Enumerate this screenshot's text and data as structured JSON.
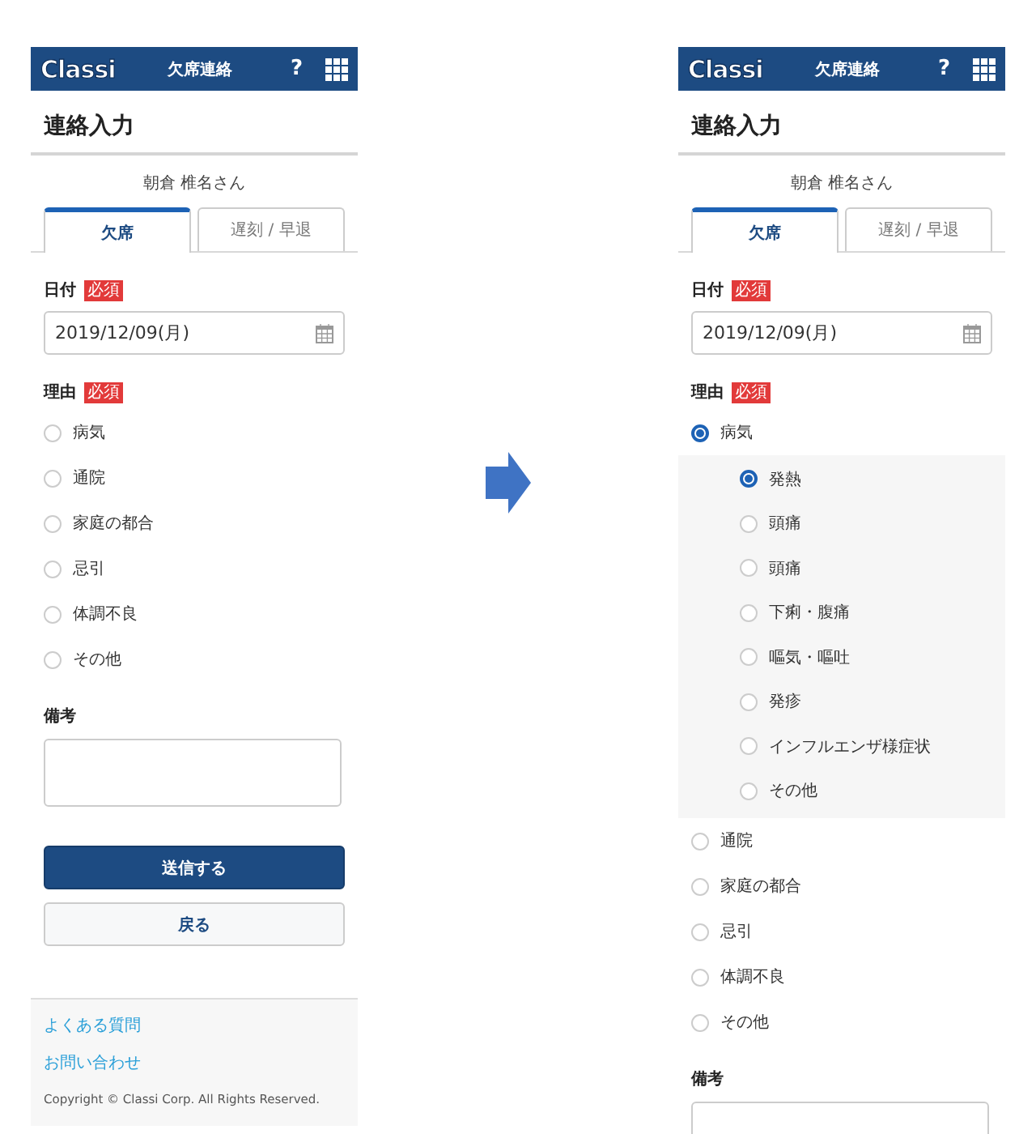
{
  "screens": [
    {
      "header": {
        "logo": "Classi",
        "title": "欠席連絡",
        "help": "?"
      },
      "page_title": "連絡入力",
      "student": "朝倉 椎名さん",
      "tabs": [
        {
          "label": "欠席",
          "selected": true
        },
        {
          "label": "遅刻 / 早退",
          "selected": false
        }
      ],
      "date": {
        "label": "日付",
        "required": true,
        "badge": "必須",
        "value": "2019/12/09(月)"
      },
      "reason": {
        "label": "理由",
        "required": true,
        "badge": "必須",
        "options": [
          {
            "label": "病気",
            "selected": false
          },
          {
            "label": "通院",
            "selected": false
          },
          {
            "label": "家庭の都合",
            "selected": false
          },
          {
            "label": "忌引",
            "selected": false
          },
          {
            "label": "体調不良",
            "selected": false
          },
          {
            "label": "その他",
            "selected": false
          }
        ]
      },
      "notes": {
        "label": "備考"
      },
      "buttons": [
        {
          "label": "送信する",
          "kind": "primary"
        },
        {
          "label": "戻る",
          "kind": "secondary"
        }
      ],
      "footer": {
        "links": [
          "よくある質問",
          "お問い合わせ"
        ],
        "copyright": "Copyright © Classi Corp. All Rights Reserved."
      }
    },
    {
      "header": {
        "logo": "Classi",
        "title": "欠席連絡",
        "help": "?"
      },
      "page_title": "連絡入力",
      "student": "朝倉 椎名さん",
      "tabs": [
        {
          "label": "欠席",
          "selected": true
        },
        {
          "label": "遅刻 / 早退",
          "selected": false
        }
      ],
      "date": {
        "label": "日付",
        "required": true,
        "badge": "必須",
        "value": "2019/12/09(月)"
      },
      "reason": {
        "label": "理由",
        "required": true,
        "badge": "必須",
        "options": [
          {
            "label": "病気",
            "selected": true,
            "children": [
              {
                "label": "発熱",
                "selected": true
              },
              {
                "label": "頭痛",
                "selected": false
              },
              {
                "label": "頭痛",
                "selected": false
              },
              {
                "label": "下痢・腹痛",
                "selected": false
              },
              {
                "label": "嘔気・嘔吐",
                "selected": false
              },
              {
                "label": "発疹",
                "selected": false
              },
              {
                "label": "インフルエンザ様症状",
                "selected": false
              },
              {
                "label": "その他",
                "selected": false
              }
            ]
          },
          {
            "label": "通院",
            "selected": false
          },
          {
            "label": "家庭の都合",
            "selected": false
          },
          {
            "label": "忌引",
            "selected": false
          },
          {
            "label": "体調不良",
            "selected": false
          },
          {
            "label": "その他",
            "selected": false
          }
        ]
      },
      "notes": {
        "label": "備考"
      }
    }
  ]
}
